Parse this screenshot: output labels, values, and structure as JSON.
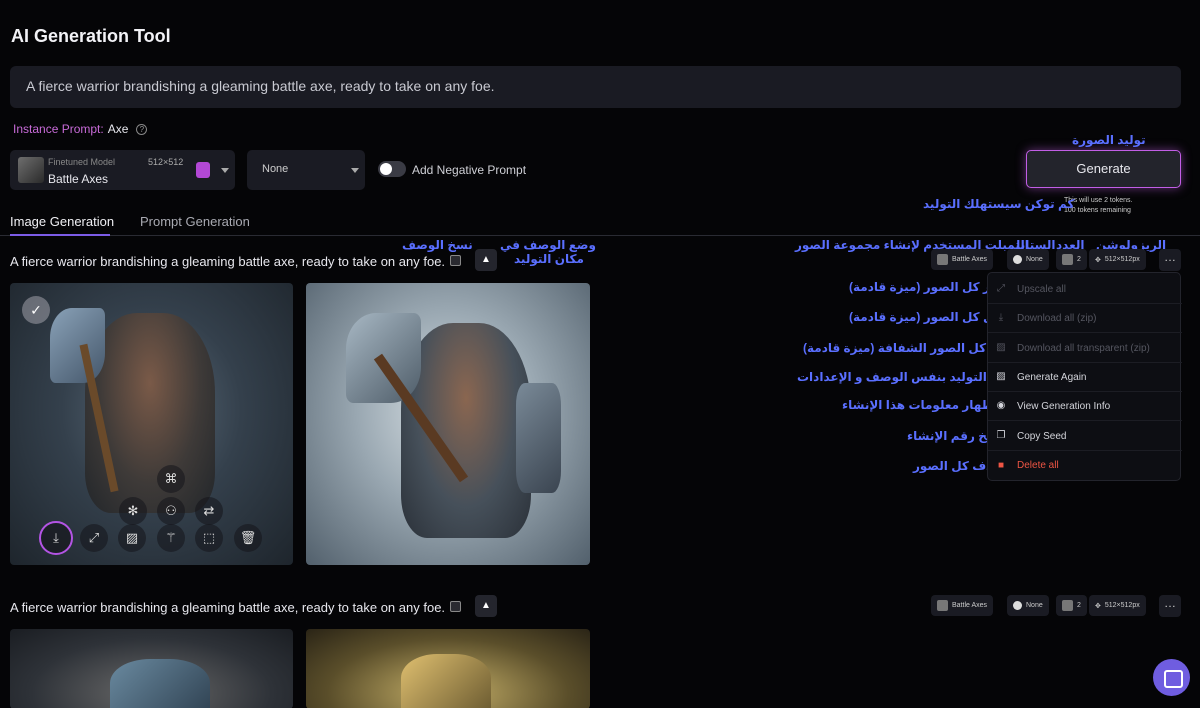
{
  "app": {
    "title": "AI Generation Tool"
  },
  "prompt": {
    "text": "A fierce warrior brandishing a gleaming battle axe, ready to take on any foe."
  },
  "instance": {
    "label": "Instance Prompt:",
    "value": "Axe"
  },
  "model": {
    "kind": "Finetuned Model",
    "name": "Battle Axes",
    "resolution": "512×512"
  },
  "style_select": {
    "value": "None"
  },
  "negative": {
    "label": "Add Negative Prompt",
    "enabled": false
  },
  "generate": {
    "label": "Generate",
    "note_line1": "This will use 2 tokens.",
    "note_line2": "100 tokens remaining"
  },
  "tabs": [
    {
      "label": "Image Generation",
      "active": true
    },
    {
      "label": "Prompt Generation",
      "active": false
    }
  ],
  "rows": [
    {
      "prompt": "A fierce warrior brandishing a gleaming battle axe, ready to take on any foe.",
      "model": "Battle Axes",
      "style": "None",
      "count": "2",
      "resolution": "512×512px"
    },
    {
      "prompt": "A fierce warrior brandishing a gleaming battle axe, ready to take on any foe.",
      "model": "Battle Axes",
      "style": "None",
      "count": "2",
      "resolution": "512×512px"
    }
  ],
  "menu": {
    "items": [
      {
        "label": "Upscale all",
        "icon": "upscale-icon",
        "enabled": false
      },
      {
        "label": "Download all (zip)",
        "icon": "download-icon",
        "enabled": false
      },
      {
        "label": "Download all transparent (zip)",
        "icon": "transparent-icon",
        "enabled": false
      },
      {
        "label": "Generate Again",
        "icon": "regenerate-icon",
        "enabled": true
      },
      {
        "label": "View Generation Info",
        "icon": "eye-icon",
        "enabled": true
      },
      {
        "label": "Copy Seed",
        "icon": "copy-icon",
        "enabled": true
      },
      {
        "label": "Delete all",
        "icon": "trash-icon",
        "enabled": true,
        "danger": true
      }
    ]
  },
  "annotations": {
    "generate_image": "توليد الصورة",
    "token_cost": "كم توكن سيستهلك التوليد",
    "copy_prompt": "نسخ الوصف",
    "put_prompt_line1": "وضع الوصف في",
    "put_prompt_line2": "مكان التوليد",
    "model_used": "التمبلت المستخدم لإنشاء مجموعة الصور",
    "style": "الستايل",
    "count": "العدد",
    "resolution": "الريزولوشن",
    "upscale": "تكبير كل الصور (ميزة قادمة)",
    "download": "تنزيل كل الصور (ميزة قادمة)",
    "download_transparent": "تنزيل كل الصور الشفافة (ميزة قادمة)",
    "regenerate": "إعادة التوليد بنفس الوصف و الإعدادات",
    "info": "إظهار معلومات هذا الإنشاء",
    "seed": "نسخ رقم الإنشاء",
    "delete": "حذف كل الصور"
  },
  "colors": {
    "accent": "#c25ee6",
    "annotation": "#5a6fff",
    "danger": "#ee5544",
    "chat": "#6f5de0"
  }
}
